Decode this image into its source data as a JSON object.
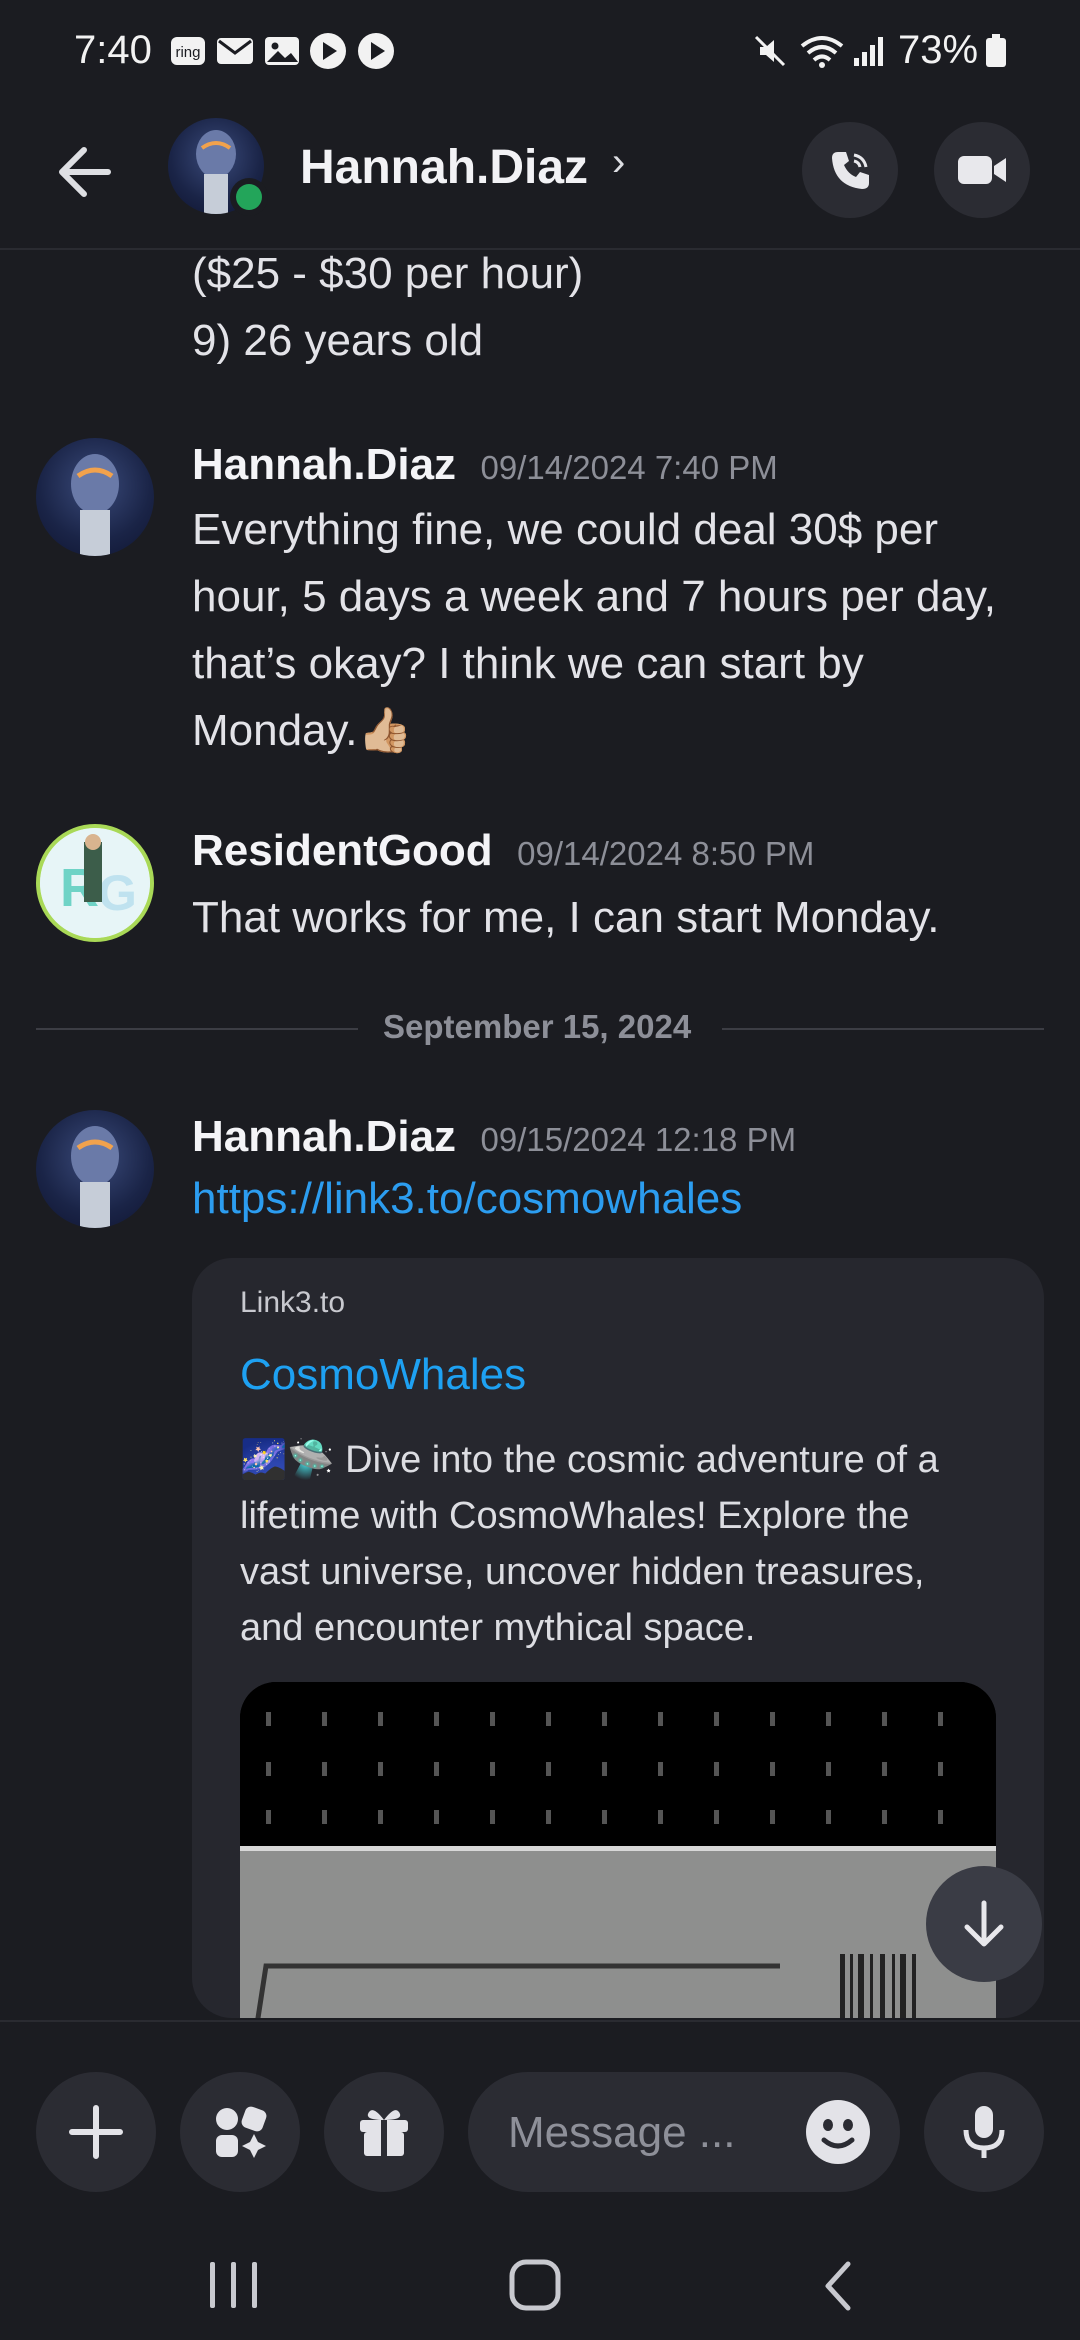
{
  "status_bar": {
    "time": "7:40",
    "notification_icons": [
      "ring-icon",
      "mail-icon",
      "gallery-icon",
      "play-icon",
      "play-icon"
    ],
    "ring_label": "ring",
    "right_icons": [
      "mute-icon",
      "wifi-icon",
      "signal-icon"
    ],
    "battery": "73%"
  },
  "header": {
    "contact_name": "Hannah.Diaz",
    "chevron": "›",
    "online_status_color": "#23a55a"
  },
  "messages": {
    "continued_lines": [
      "($25 - $30 per hour)",
      "9) 26 years old"
    ],
    "msg1": {
      "author": "Hannah.Diaz",
      "timestamp": "09/14/2024 7:40 PM",
      "lines": [
        "Everything fine, we could deal 30$ per",
        "hour, 5 days a week and 7 hours per day,",
        "that’s okay? I think we can start by",
        "Monday.👍🏼"
      ]
    },
    "msg2": {
      "author": "ResidentGood",
      "timestamp": "09/14/2024 8:50 PM",
      "text": "That works for me, I can start Monday."
    },
    "date_divider": "September 15, 2024",
    "msg3": {
      "author": "Hannah.Diaz",
      "timestamp": "09/15/2024 12:18 PM",
      "link": "https://link3.to/cosmowhales"
    }
  },
  "embed": {
    "provider": "Link3.to",
    "title": "CosmoWhales",
    "description_lines": [
      "🌌🛸 Dive into the cosmic adventure of a",
      "lifetime with CosmoWhales! Explore the",
      "vast universe, uncover hidden treasures,",
      "and encounter mythical space."
    ]
  },
  "composer": {
    "placeholder": "Message ..."
  },
  "colors": {
    "background": "#1b1c21",
    "link": "#2c9df0",
    "embed_bg": "#26272e"
  }
}
